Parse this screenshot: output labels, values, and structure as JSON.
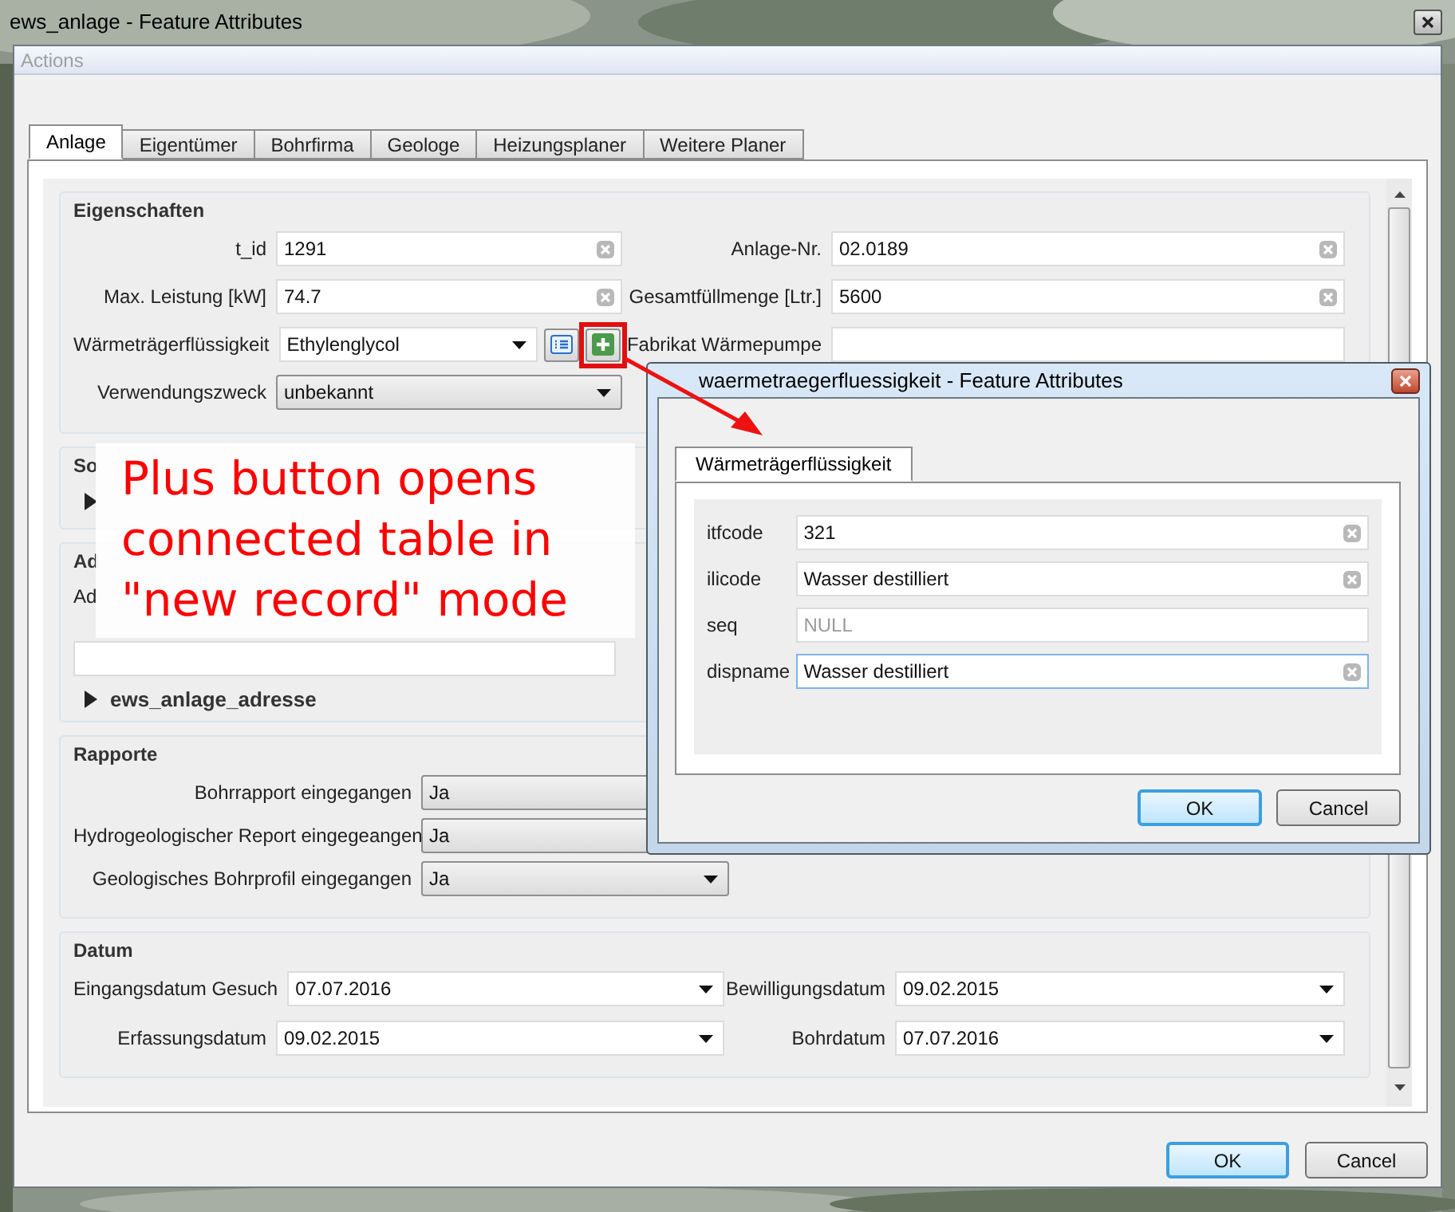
{
  "window": {
    "title": "ews_anlage - Feature Attributes"
  },
  "menu": [
    {
      "label": "Actions",
      "disabled": true
    }
  ],
  "tabs": [
    {
      "label": "Anlage",
      "selected": true
    },
    {
      "label": "Eigentümer",
      "selected": false
    },
    {
      "label": "Bohrfirma",
      "selected": false
    },
    {
      "label": "Geologe",
      "selected": false
    },
    {
      "label": "Heizungsplaner",
      "selected": false
    },
    {
      "label": "Weitere Planer",
      "selected": false
    }
  ],
  "eigenschaften": {
    "title": "Eigenschaften",
    "left": [
      {
        "kind": "text",
        "label": "t_id",
        "value": "1291"
      },
      {
        "kind": "text",
        "label": "Max. Leistung [kW]",
        "value": "74.7"
      },
      {
        "kind": "relation",
        "label": "Wärmeträgerflüssigkeit",
        "value": "Ethylenglycol",
        "highlighted": true
      },
      {
        "kind": "combo",
        "label": "Verwendungszweck",
        "value": "unbekannt"
      }
    ],
    "right": [
      {
        "kind": "text",
        "label": "Anlage-Nr.",
        "value": "02.0189"
      },
      {
        "kind": "text",
        "label": "Gesamtfüllmenge [Ltr.]",
        "value": "5600"
      },
      {
        "kind": "empty",
        "label": "Fabrikat Wärmepumpe"
      }
    ]
  },
  "sondengruppen": {
    "title": "So",
    "expanded": false
  },
  "adresse": {
    "title": "Ad",
    "label": "Ad",
    "relation": "ews_anlage_adresse",
    "expanded": false
  },
  "rapporte": {
    "title": "Rapporte",
    "rows": [
      {
        "label": "Bohrrapport eingegangen",
        "value": "Ja"
      },
      {
        "label": "Hydrogeologischer Report eingegeangen",
        "value": "Ja"
      },
      {
        "label": "Geologisches Bohrprofil eingegangen",
        "value": "Ja"
      }
    ]
  },
  "datum": {
    "title": "Datum",
    "rows": [
      [
        {
          "label": "Eingangsdatum Gesuch",
          "value": "07.07.2016"
        },
        {
          "label": "Bewilligungsdatum",
          "value": "09.02.2015"
        }
      ],
      [
        {
          "label": "Erfassungsdatum",
          "value": "09.02.2015"
        },
        {
          "label": "Bohrdatum",
          "value": "07.07.2016"
        }
      ]
    ]
  },
  "buttons": [
    {
      "label": "OK",
      "default": true
    },
    {
      "label": "Cancel",
      "default": false
    }
  ],
  "dialog": {
    "title": "waermetraegerfluessigkeit - Feature Attributes",
    "tabs": [
      {
        "label": "Wärmeträgerflüssigkeit",
        "selected": true
      }
    ],
    "fields": [
      {
        "label": "itfcode",
        "value": "321",
        "focused": false
      },
      {
        "label": "ilicode",
        "value": "Wasser destilliert",
        "focused": false
      },
      {
        "label": "seq",
        "placeholder": "NULL",
        "focused": false
      },
      {
        "label": "dispname",
        "value": "Wasser destilliert",
        "focused": true
      }
    ],
    "buttons": [
      {
        "label": "OK",
        "default": true
      },
      {
        "label": "Cancel",
        "default": false
      }
    ]
  },
  "annotation": {
    "lines": [
      "Plus button opens",
      "connected table in",
      "\"new record\" mode"
    ]
  }
}
